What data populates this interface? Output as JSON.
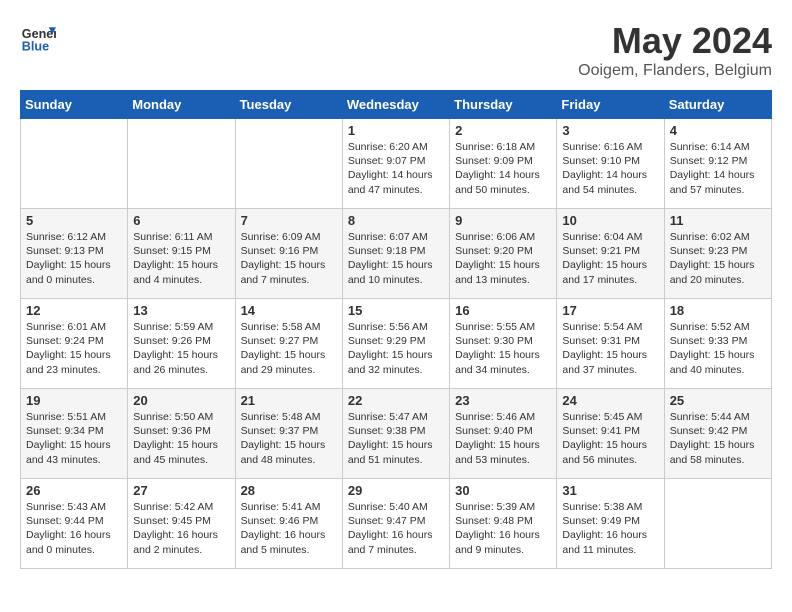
{
  "header": {
    "logo_line1": "General",
    "logo_line2": "Blue",
    "title": "May 2024",
    "subtitle": "Ooigem, Flanders, Belgium"
  },
  "days_of_week": [
    "Sunday",
    "Monday",
    "Tuesday",
    "Wednesday",
    "Thursday",
    "Friday",
    "Saturday"
  ],
  "weeks": [
    [
      {
        "num": "",
        "info": ""
      },
      {
        "num": "",
        "info": ""
      },
      {
        "num": "",
        "info": ""
      },
      {
        "num": "1",
        "info": "Sunrise: 6:20 AM\nSunset: 9:07 PM\nDaylight: 14 hours and 47 minutes."
      },
      {
        "num": "2",
        "info": "Sunrise: 6:18 AM\nSunset: 9:09 PM\nDaylight: 14 hours and 50 minutes."
      },
      {
        "num": "3",
        "info": "Sunrise: 6:16 AM\nSunset: 9:10 PM\nDaylight: 14 hours and 54 minutes."
      },
      {
        "num": "4",
        "info": "Sunrise: 6:14 AM\nSunset: 9:12 PM\nDaylight: 14 hours and 57 minutes."
      }
    ],
    [
      {
        "num": "5",
        "info": "Sunrise: 6:12 AM\nSunset: 9:13 PM\nDaylight: 15 hours and 0 minutes."
      },
      {
        "num": "6",
        "info": "Sunrise: 6:11 AM\nSunset: 9:15 PM\nDaylight: 15 hours and 4 minutes."
      },
      {
        "num": "7",
        "info": "Sunrise: 6:09 AM\nSunset: 9:16 PM\nDaylight: 15 hours and 7 minutes."
      },
      {
        "num": "8",
        "info": "Sunrise: 6:07 AM\nSunset: 9:18 PM\nDaylight: 15 hours and 10 minutes."
      },
      {
        "num": "9",
        "info": "Sunrise: 6:06 AM\nSunset: 9:20 PM\nDaylight: 15 hours and 13 minutes."
      },
      {
        "num": "10",
        "info": "Sunrise: 6:04 AM\nSunset: 9:21 PM\nDaylight: 15 hours and 17 minutes."
      },
      {
        "num": "11",
        "info": "Sunrise: 6:02 AM\nSunset: 9:23 PM\nDaylight: 15 hours and 20 minutes."
      }
    ],
    [
      {
        "num": "12",
        "info": "Sunrise: 6:01 AM\nSunset: 9:24 PM\nDaylight: 15 hours and 23 minutes."
      },
      {
        "num": "13",
        "info": "Sunrise: 5:59 AM\nSunset: 9:26 PM\nDaylight: 15 hours and 26 minutes."
      },
      {
        "num": "14",
        "info": "Sunrise: 5:58 AM\nSunset: 9:27 PM\nDaylight: 15 hours and 29 minutes."
      },
      {
        "num": "15",
        "info": "Sunrise: 5:56 AM\nSunset: 9:29 PM\nDaylight: 15 hours and 32 minutes."
      },
      {
        "num": "16",
        "info": "Sunrise: 5:55 AM\nSunset: 9:30 PM\nDaylight: 15 hours and 34 minutes."
      },
      {
        "num": "17",
        "info": "Sunrise: 5:54 AM\nSunset: 9:31 PM\nDaylight: 15 hours and 37 minutes."
      },
      {
        "num": "18",
        "info": "Sunrise: 5:52 AM\nSunset: 9:33 PM\nDaylight: 15 hours and 40 minutes."
      }
    ],
    [
      {
        "num": "19",
        "info": "Sunrise: 5:51 AM\nSunset: 9:34 PM\nDaylight: 15 hours and 43 minutes."
      },
      {
        "num": "20",
        "info": "Sunrise: 5:50 AM\nSunset: 9:36 PM\nDaylight: 15 hours and 45 minutes."
      },
      {
        "num": "21",
        "info": "Sunrise: 5:48 AM\nSunset: 9:37 PM\nDaylight: 15 hours and 48 minutes."
      },
      {
        "num": "22",
        "info": "Sunrise: 5:47 AM\nSunset: 9:38 PM\nDaylight: 15 hours and 51 minutes."
      },
      {
        "num": "23",
        "info": "Sunrise: 5:46 AM\nSunset: 9:40 PM\nDaylight: 15 hours and 53 minutes."
      },
      {
        "num": "24",
        "info": "Sunrise: 5:45 AM\nSunset: 9:41 PM\nDaylight: 15 hours and 56 minutes."
      },
      {
        "num": "25",
        "info": "Sunrise: 5:44 AM\nSunset: 9:42 PM\nDaylight: 15 hours and 58 minutes."
      }
    ],
    [
      {
        "num": "26",
        "info": "Sunrise: 5:43 AM\nSunset: 9:44 PM\nDaylight: 16 hours and 0 minutes."
      },
      {
        "num": "27",
        "info": "Sunrise: 5:42 AM\nSunset: 9:45 PM\nDaylight: 16 hours and 2 minutes."
      },
      {
        "num": "28",
        "info": "Sunrise: 5:41 AM\nSunset: 9:46 PM\nDaylight: 16 hours and 5 minutes."
      },
      {
        "num": "29",
        "info": "Sunrise: 5:40 AM\nSunset: 9:47 PM\nDaylight: 16 hours and 7 minutes."
      },
      {
        "num": "30",
        "info": "Sunrise: 5:39 AM\nSunset: 9:48 PM\nDaylight: 16 hours and 9 minutes."
      },
      {
        "num": "31",
        "info": "Sunrise: 5:38 AM\nSunset: 9:49 PM\nDaylight: 16 hours and 11 minutes."
      },
      {
        "num": "",
        "info": ""
      }
    ]
  ]
}
